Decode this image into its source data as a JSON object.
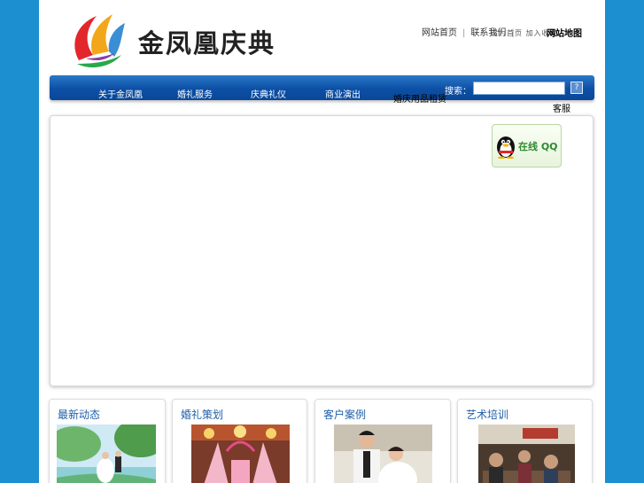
{
  "header": {
    "brand_name": "金凤凰庆典",
    "top_links": [
      {
        "label": "网站首页"
      },
      {
        "label": "联系我们"
      }
    ],
    "separator": "|",
    "corner_text": "网站地图",
    "under_links_text": "设为首页 加入收藏",
    "glitch_left": "",
    "glitch_right": ""
  },
  "nav": {
    "items": [
      {
        "label": "关于金凤凰"
      },
      {
        "label": "婚礼服务"
      },
      {
        "label": "庆典礼仪"
      },
      {
        "label": "商业演出"
      }
    ],
    "extra_text": "婚庆用品租赁",
    "search": {
      "label": "搜索：",
      "value": "",
      "placeholder": "",
      "button_label": "?"
    }
  },
  "banner": {
    "qq_button_label": "在线 QQ",
    "marker_text": "客服",
    "glitch_markers": [
      "",
      "",
      "",
      "",
      ""
    ]
  },
  "columns": [
    {
      "title": "最新动态"
    },
    {
      "title": "婚礼策划"
    },
    {
      "title": "客户案例"
    },
    {
      "title": "艺术培训"
    }
  ],
  "colors": {
    "background": "#1b8fd0",
    "nav_blue": "#0c4fa6",
    "title_blue": "#1f5fa8",
    "qq_green": "#2e8b2e"
  }
}
